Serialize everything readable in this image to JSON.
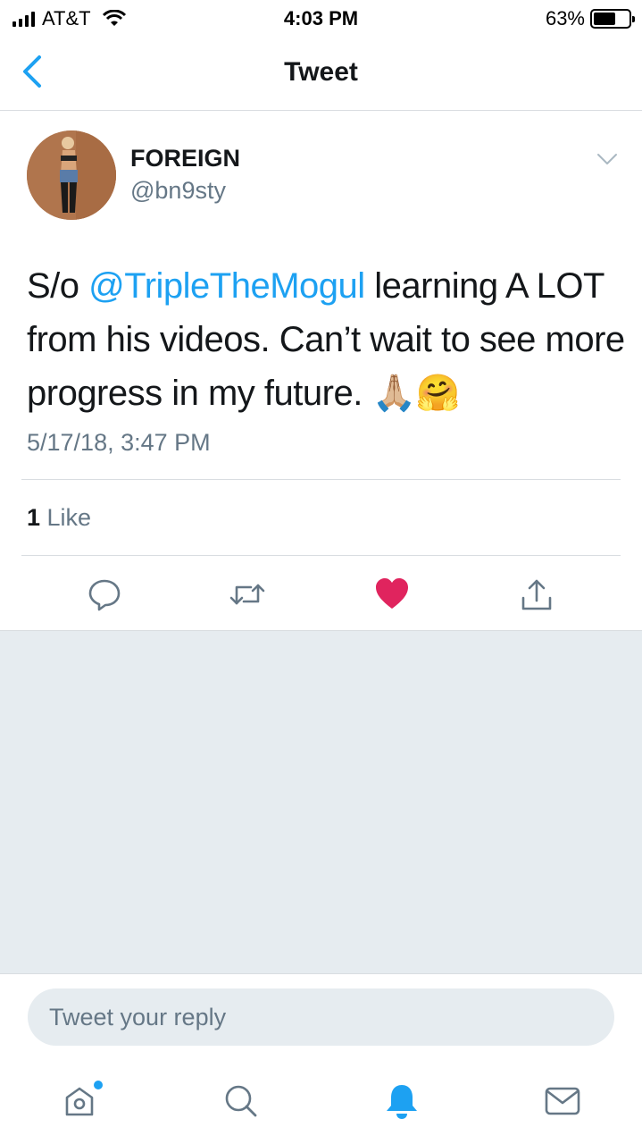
{
  "status_bar": {
    "carrier": "AT&T",
    "time": "4:03 PM",
    "battery_percent": "63%",
    "battery_level": 0.63
  },
  "nav": {
    "title": "Tweet",
    "back_icon": "chevron-left-icon"
  },
  "tweet": {
    "display_name": "FOREIGN",
    "handle": "@bn9sty",
    "text_prefix": "S/o ",
    "mention": "@TripleTheMogul",
    "text_suffix": " learning A LOT from his videos. Can’t wait to see more progress in my future. ",
    "emoji": "🙏🏼🤗",
    "timestamp": "5/17/18, 3:47 PM",
    "like_count": "1",
    "like_label": " Like",
    "liked": true
  },
  "actions": {
    "reply_icon": "reply-icon",
    "retweet_icon": "retweet-icon",
    "like_icon": "heart-icon",
    "share_icon": "share-icon"
  },
  "reply": {
    "placeholder": "Tweet your reply"
  },
  "tabs": [
    {
      "icon": "home-icon",
      "has_notification_dot": true
    },
    {
      "icon": "search-icon"
    },
    {
      "icon": "bell-icon",
      "active": true
    },
    {
      "icon": "mail-icon"
    }
  ],
  "colors": {
    "accent": "#1da1f2",
    "like": "#e0245e",
    "text": "#14171a",
    "secondary": "#657786",
    "background_gray": "#e6ecf0"
  }
}
